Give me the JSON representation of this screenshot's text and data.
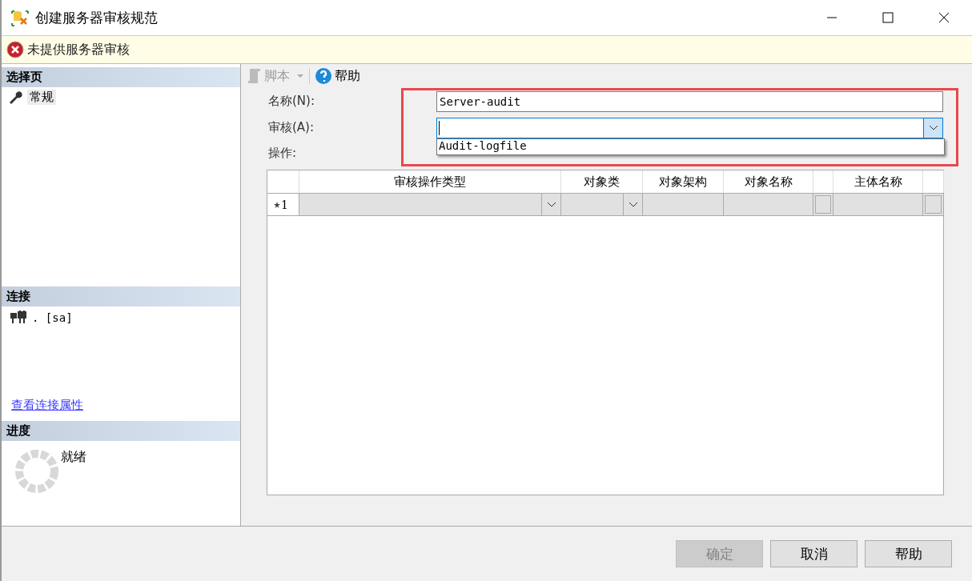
{
  "window": {
    "title": "创建服务器审核规范"
  },
  "error_bar": {
    "message": "未提供服务器审核"
  },
  "sidebar": {
    "select_page": {
      "header": "选择页",
      "items": [
        {
          "label": "常规",
          "selected": true
        }
      ]
    },
    "connection": {
      "header": "连接",
      "server": ". [sa]",
      "link": "查看连接属性"
    },
    "progress": {
      "header": "进度",
      "status": "就绪"
    }
  },
  "toolbar": [
    {
      "kind": "script",
      "label": "脚本",
      "disabled": true
    },
    {
      "kind": "help",
      "label": "帮助",
      "disabled": false
    }
  ],
  "form": {
    "name": {
      "label": "名称(N):",
      "value": "Server-audit"
    },
    "audit": {
      "label": "审核(A):",
      "expanded": true,
      "options": [
        {
          "label": "Audit-logfile",
          "selected": false
        }
      ]
    },
    "operations_label": "操作:"
  },
  "grid": {
    "columns": [
      {
        "kind": "combo",
        "label": "审核操作类型"
      },
      {
        "kind": "combo",
        "label": "对象类"
      },
      {
        "kind": "text",
        "label": "对象架构"
      },
      {
        "kind": "text",
        "label": "对象名称"
      },
      {
        "kind": "button"
      },
      {
        "kind": "text",
        "label": "主体名称"
      },
      {
        "kind": "button"
      }
    ],
    "rows": [
      {
        "number": "1",
        "new": true
      }
    ]
  },
  "buttons": [
    {
      "label": "确定",
      "disabled": true
    },
    {
      "label": "取消",
      "disabled": false
    },
    {
      "label": "帮助",
      "disabled": false
    }
  ]
}
